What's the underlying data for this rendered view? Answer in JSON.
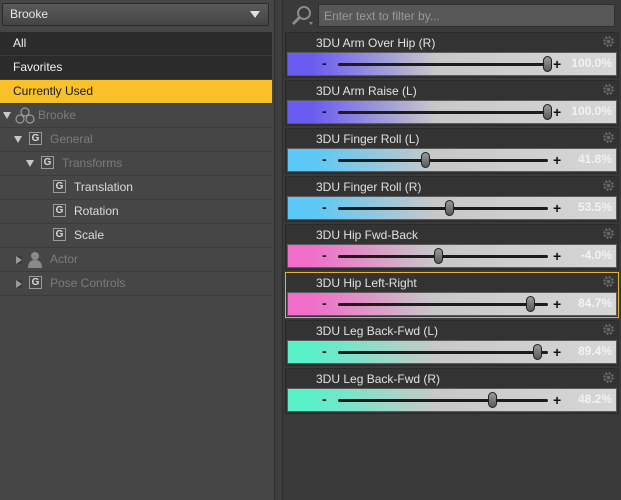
{
  "figure_select": {
    "value": "Brooke"
  },
  "tree": {
    "top": [
      "All",
      "Favorites",
      "Currently Used"
    ],
    "figure": "Brooke",
    "general": "General",
    "transforms": "Transforms",
    "translation": "Translation",
    "rotation": "Rotation",
    "scale": "Scale",
    "actor": "Actor",
    "pose_controls": "Pose Controls"
  },
  "filter": {
    "placeholder": "Enter text to filter by..."
  },
  "params": [
    {
      "name": "3DU Arm Over Hip (R)",
      "value": "100.0%",
      "fraction": 1.0,
      "color": "#6a5cf0"
    },
    {
      "name": "3DU Arm Raise (L)",
      "value": "100.0%",
      "fraction": 1.0,
      "color": "#6a5cf0"
    },
    {
      "name": "3DU Finger Roll (L)",
      "value": "41.8%",
      "fraction": 0.418,
      "color": "#5bc8f5"
    },
    {
      "name": "3DU Finger Roll (R)",
      "value": "53.5%",
      "fraction": 0.535,
      "color": "#5bc8f5"
    },
    {
      "name": "3DU Hip Fwd-Back",
      "value": "-4.0%",
      "fraction": 0.48,
      "color": "#f06ec8"
    },
    {
      "name": "3DU Hip Left-Right",
      "value": "84.7%",
      "fraction": 0.92,
      "color": "#f06ec8"
    },
    {
      "name": "3DU Leg Back-Fwd (L)",
      "value": "89.4%",
      "fraction": 0.95,
      "color": "#5af0c8"
    },
    {
      "name": "3DU Leg Back-Fwd (R)",
      "value": "48.2%",
      "fraction": 0.74,
      "color": "#5af0c8"
    }
  ],
  "colors": {
    "selected": "#f8c12a",
    "active_border": "#e4b23a"
  }
}
